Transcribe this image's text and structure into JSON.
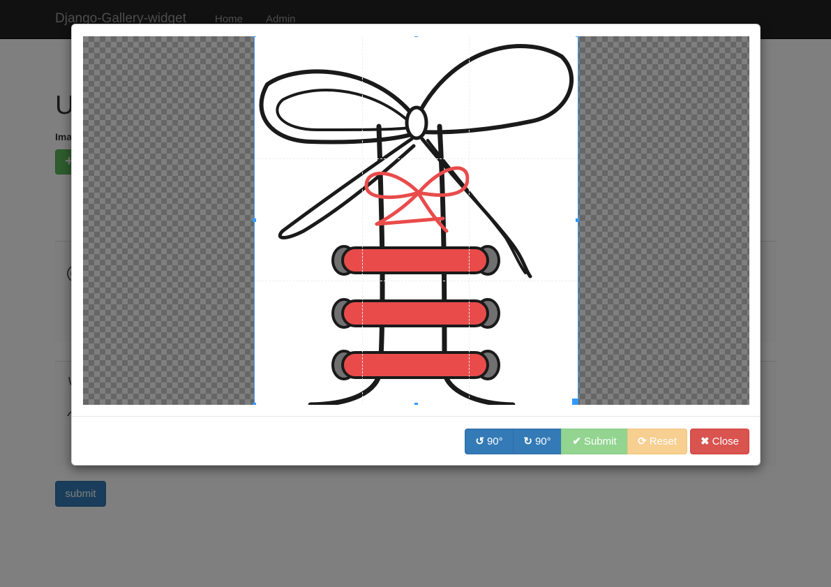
{
  "navbar": {
    "brand": "Django-Gallery-widget",
    "links": [
      "Home",
      "Admin"
    ]
  },
  "page": {
    "heading": "U",
    "field_label": "Ima",
    "add_button": "+",
    "submit_label": "submit"
  },
  "modal": {
    "buttons": {
      "rotate_left": "90°",
      "rotate_right": "90°",
      "submit": "Submit",
      "reset": "Reset",
      "close": "Close"
    }
  },
  "icons": {
    "rotate_left": "rotate-left-icon",
    "rotate_right": "rotate-right-icon",
    "submit": "check-icon",
    "reset": "refresh-icon",
    "close": "close-icon"
  },
  "colors": {
    "primary": "#337ab7",
    "success_disabled": "#92d490",
    "warning_disabled": "#f7cf90",
    "danger": "#d9534f",
    "crop_outline": "#3399ff",
    "lace_red": "#e94b4b"
  }
}
